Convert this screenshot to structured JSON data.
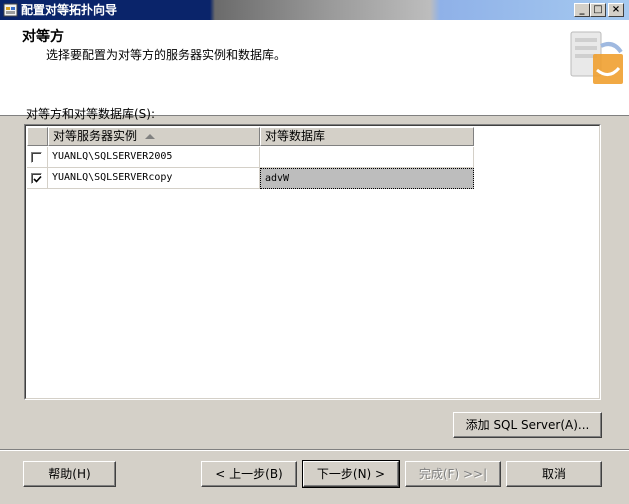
{
  "window": {
    "title": "配置对等拓扑向导",
    "minimize": "_",
    "maximize": "□",
    "close": "×"
  },
  "header": {
    "title": "对等方",
    "subtitle": "选择要配置为对等方的服务器实例和数据库。"
  },
  "section_label": "对等方和对等数据库(S):",
  "grid": {
    "columns": [
      "对等服务器实例",
      "对等数据库"
    ],
    "rows": [
      {
        "checked": false,
        "server": "YUANLQ\\SQLSERVER2005",
        "database": ""
      },
      {
        "checked": true,
        "server": "YUANLQ\\SQLSERVERcopy",
        "database": "advW"
      }
    ]
  },
  "buttons": {
    "add_sql_server": "添加 SQL Server(A)...",
    "help": "帮助(H)",
    "back": "< 上一步(B)",
    "next": "下一步(N) >",
    "finish": "完成(F) >>|",
    "cancel": "取消"
  },
  "colors": {
    "titlebar_active": "#0a246a",
    "dialog_face": "#d4d0c8",
    "selected_cell": "#bdbdbd"
  }
}
